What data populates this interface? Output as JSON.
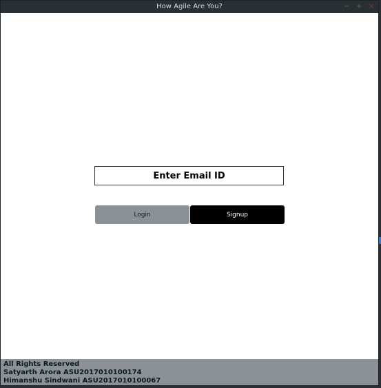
{
  "window": {
    "title": "How Agile Are You?",
    "controls": [
      "minimize-icon",
      "maximize-icon",
      "close-icon"
    ]
  },
  "form": {
    "email_placeholder": "Enter Email ID",
    "email_value": ""
  },
  "buttons": {
    "login_label": "Login",
    "signup_label": "Signup"
  },
  "footer": {
    "lines": [
      "All Rights Reserved",
      "Satyarth Arora ASU2017010100174",
      "Himanshu Sindwani ASU2017010100067"
    ]
  },
  "colors": {
    "titlebar": "#2a2f33",
    "login_button": "#8b9194",
    "signup_button": "#000000",
    "footer_bg": "#8b9194"
  }
}
